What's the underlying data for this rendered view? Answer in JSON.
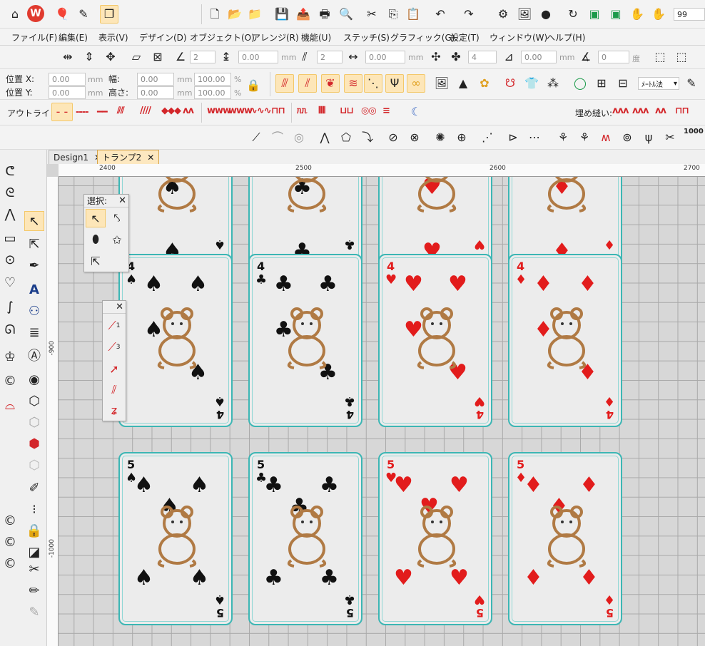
{
  "toolbar_top": {
    "zoom_value": "99"
  },
  "menu": [
    "ファイル(F)",
    "編集(E)",
    "表示(V)",
    "デザイン(D)",
    "オブジェクト(O)",
    "アレンジ(R)",
    "機能(U)",
    "ステッチ(S)",
    "グラフィック(G)",
    "設定(T)",
    "ウィンドウ(W)",
    "ヘルプ(H)"
  ],
  "props": {
    "pos_x_label": "位置 X:",
    "pos_y_label": "位置 Y:",
    "width_label": "幅:",
    "height_label": "高さ:",
    "x_value": "0.00",
    "y_value": "0.00",
    "w_value": "0.00",
    "h_value": "0.00",
    "unit_mm": "mm",
    "scale_w": "100.00",
    "scale_h": "100.00",
    "percent": "%",
    "units_select": "ﾒｰﾄﾙ法"
  },
  "row3": {
    "v1": "2",
    "v2": "0.00",
    "v3": "2",
    "v4": "0.00",
    "v5": "4",
    "v6": "0.00",
    "v7": "0",
    "mm": "mm",
    "deg": "度"
  },
  "outline_label": "アウトライン:",
  "fill_label": "埋め縫い:",
  "row6_number": "1000",
  "tabs": [
    {
      "label": "Design1"
    },
    {
      "label": "トランプ2"
    }
  ],
  "ruler": {
    "h": [
      "2400",
      "2500",
      "2600",
      "2700"
    ],
    "v": [
      "-900",
      "-1000"
    ]
  },
  "palette_select": {
    "title": "選択:"
  },
  "palette_lines": {
    "num1": "1",
    "num3": "3"
  },
  "cards": [
    {
      "rank": "3",
      "suit": "♠",
      "color": "black"
    },
    {
      "rank": "3",
      "suit": "♣",
      "color": "black"
    },
    {
      "rank": "3",
      "suit": "♥",
      "color": "red"
    },
    {
      "rank": "3",
      "suit": "♦",
      "color": "red"
    },
    {
      "rank": "4",
      "suit": "♠",
      "color": "black"
    },
    {
      "rank": "4",
      "suit": "♣",
      "color": "black"
    },
    {
      "rank": "4",
      "suit": "♥",
      "color": "red"
    },
    {
      "rank": "4",
      "suit": "♦",
      "color": "red"
    },
    {
      "rank": "5",
      "suit": "♠",
      "color": "black"
    },
    {
      "rank": "5",
      "suit": "♣",
      "color": "black"
    },
    {
      "rank": "5",
      "suit": "♥",
      "color": "red"
    },
    {
      "rank": "5",
      "suit": "♦",
      "color": "red"
    }
  ],
  "colors": {
    "card_border": "#3cb6b4",
    "accent": "#fde6b8",
    "red": "#e21c1c",
    "brown": "#b07a44"
  }
}
